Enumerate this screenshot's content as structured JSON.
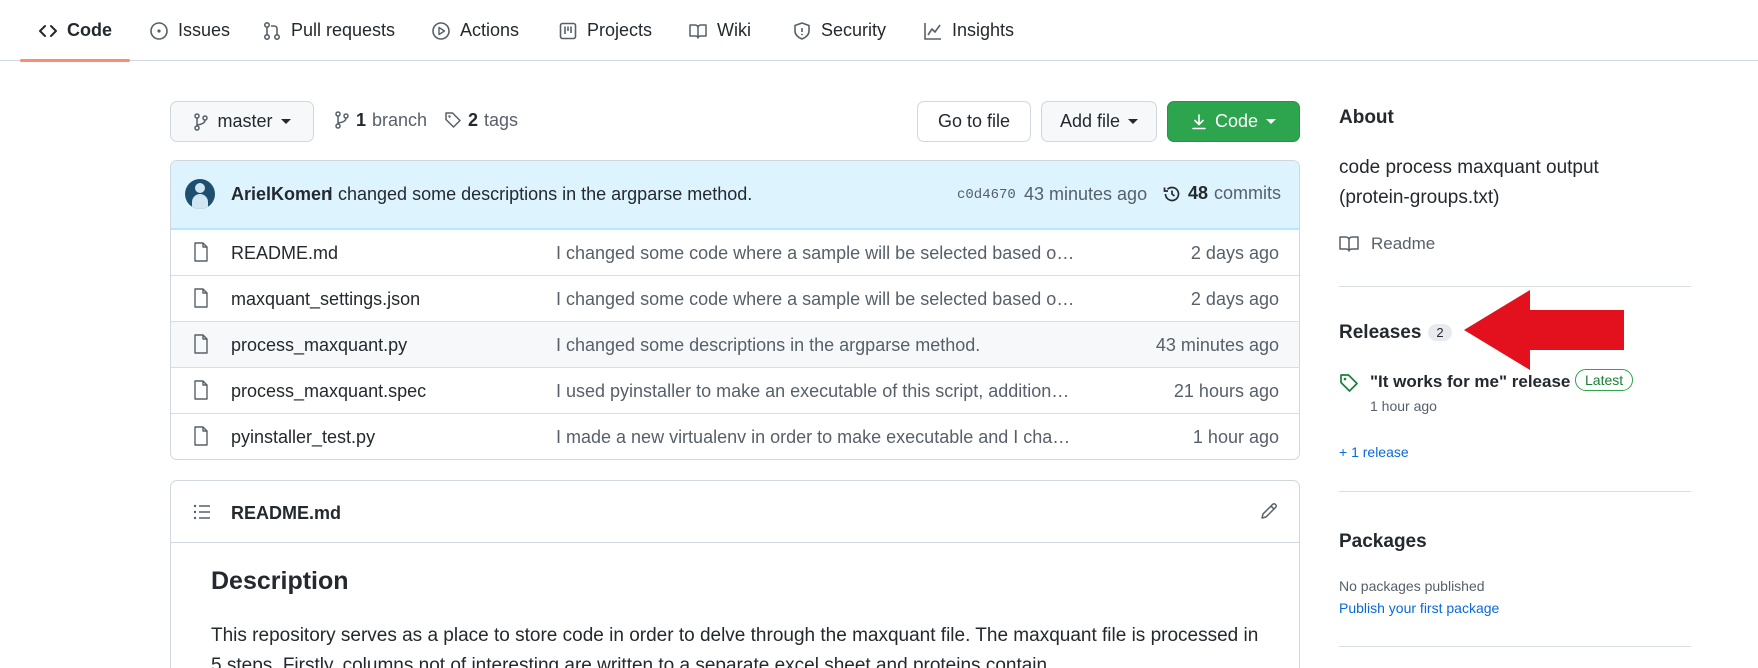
{
  "nav": {
    "tabs": [
      {
        "label": "Code",
        "icon": "code-icon"
      },
      {
        "label": "Issues",
        "icon": "issue-opened-icon"
      },
      {
        "label": "Pull requests",
        "icon": "git-pull-request-icon"
      },
      {
        "label": "Actions",
        "icon": "play-icon"
      },
      {
        "label": "Projects",
        "icon": "table-icon"
      },
      {
        "label": "Wiki",
        "icon": "book-icon"
      },
      {
        "label": "Security",
        "icon": "shield-icon"
      },
      {
        "label": "Insights",
        "icon": "graph-icon"
      }
    ],
    "active_tab": "Code",
    "active_underline_color": "#fd8c73"
  },
  "branch_bar": {
    "branch": "master",
    "branch_count": "1",
    "branch_word": "branch",
    "tag_count": "2",
    "tag_word": "tags",
    "go_to_file": "Go to file",
    "add_file": "Add file",
    "code": "Code",
    "code_button_color": "#2da44e"
  },
  "commit": {
    "author": "ArielKomen",
    "message": "I changed some descriptions in the argparse method.",
    "sha": "c0d4670",
    "age": "43 minutes ago",
    "count": "48",
    "count_word": "commits"
  },
  "files": [
    {
      "name": "README.md",
      "message": "I changed some code where a sample will be selected based on 'iBAQ ' columns and ...",
      "age": "2 days ago"
    },
    {
      "name": "maxquant_settings.json",
      "message": "I changed some code where a sample will be selected based on 'iBAQ ' columns and ...",
      "age": "2 days ago"
    },
    {
      "name": "process_maxquant.py",
      "message": "I changed some descriptions in the argparse method.",
      "age": "43 minutes ago"
    },
    {
      "name": "process_maxquant.spec",
      "message": "I used pyinstaller to make an executable of this script, additionally...",
      "age": "21 hours ago"
    },
    {
      "name": "pyinstaller_test.py",
      "message": "I made a new virtualenv in order to make executable and I changed some things",
      "age": "1 hour ago"
    }
  ],
  "readme": {
    "filename": "README.md",
    "heading": "Description",
    "paragraph": "This repository serves as a place to store code in order to delve through the maxquant file. The maxquant file is processed in 5 steps. Firstly, columns not of interesting are written to a separate excel sheet and proteins contain"
  },
  "sidebar": {
    "about_title": "About",
    "about_desc": "code process maxquant output (protein-groups.txt)",
    "readme_label": "Readme",
    "releases_title": "Releases",
    "releases_count": "2",
    "release_name": "\"It works for me\" release",
    "latest_label": "Latest",
    "release_age": "1 hour ago",
    "more_releases": "+ 1 release",
    "packages_title": "Packages",
    "packages_none": "No packages published",
    "packages_link": "Publish your first package"
  },
  "annotation": {
    "arrow_color": "#e3101e",
    "arrow_direction": "left"
  }
}
